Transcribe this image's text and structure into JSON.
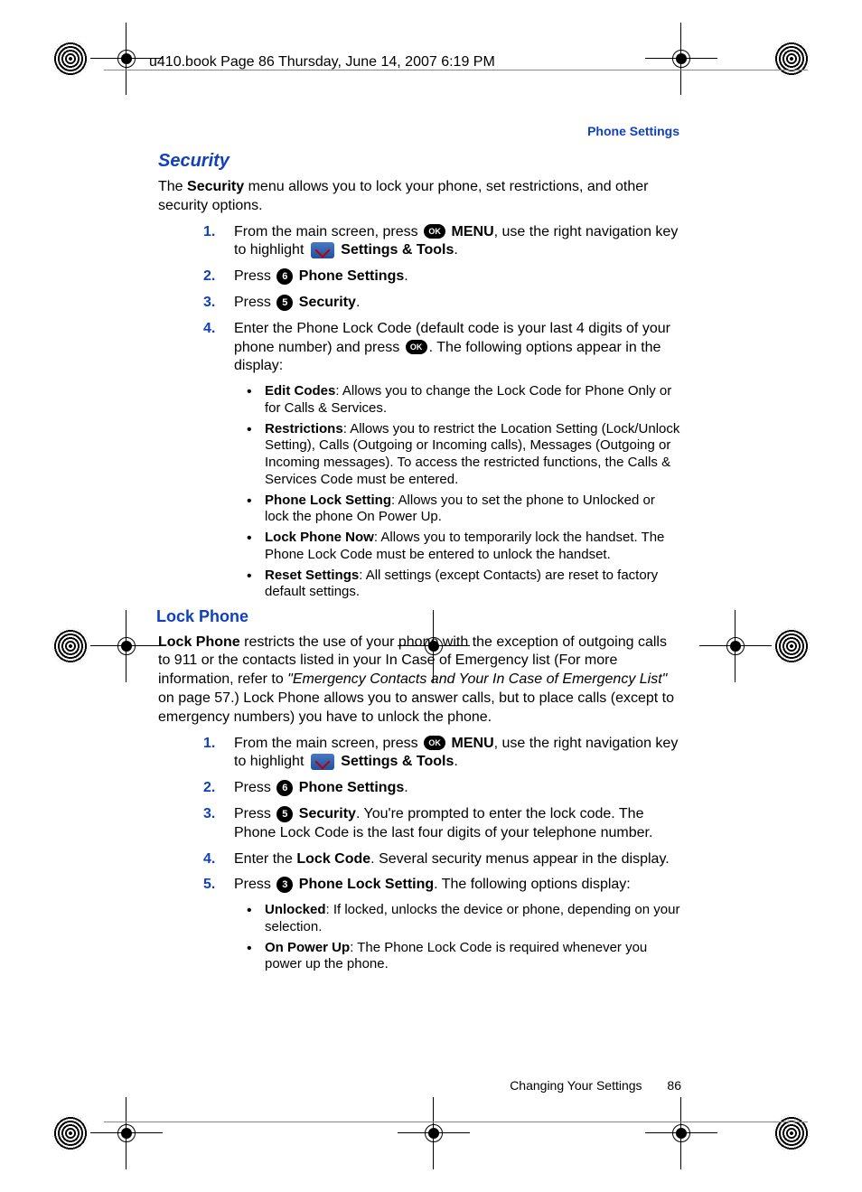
{
  "header_stamp": "u410.book  Page 86  Thursday, June 14, 2007  6:19 PM",
  "section_label": "Phone Settings",
  "h_security": "Security",
  "intro": "The <b>Security</b> menu allows you to lock your phone, set restrictions, and other security options.",
  "steps1": [
    "From the main screen, press [OK] <b>MENU</b>, use the right navigation key to highlight [ST] <b>Settings & Tools</b>.",
    "Press [6] <b>Phone Settings</b>.",
    "Press [5] <b>Security</b>.",
    "Enter the Phone Lock Code (default code is your last 4 digits of your phone number) and press [OK]. The following options appear in the display:"
  ],
  "bullets1": [
    "<b>Edit Codes</b>: Allows you to change the Lock Code for Phone Only or for Calls & Services.",
    "<b>Restrictions</b>: Allows you to restrict the Location Setting (Lock/Unlock Setting), Calls (Outgoing or Incoming calls), Messages (Outgoing or Incoming messages). To access the restricted functions, the Calls & Services Code must be entered.",
    "<b>Phone Lock Setting</b>: Allows you to set the phone to Unlocked or lock the phone On Power Up.",
    "<b>Lock Phone Now</b>: Allows you to temporarily lock the handset. The Phone Lock Code must be entered to unlock the handset.",
    "<b>Reset Settings</b>: All settings (except Contacts) are reset to factory default settings."
  ],
  "h_lockphone": "Lock Phone",
  "lockphone_intro": "<b>Lock Phone</b> restricts the use of your phone with the exception of outgoing calls to 911 or the contacts listed in your In Case of Emergency list (For more information, refer to <i>\"Emergency Contacts and Your In Case of Emergency List\"</i>  on page 57.) Lock Phone allows you to answer calls, but to place calls (except to emergency numbers) you have to unlock the phone.",
  "steps2": [
    "From the main screen, press [OK] <b>MENU</b>, use the right navigation key to highlight [ST] <b>Settings & Tools</b>.",
    "Press [6] <b>Phone Settings</b>.",
    "Press [5] <b>Security</b>. You're prompted to enter the lock code. The Phone Lock Code is the last four digits of your telephone number.",
    "Enter the <b>Lock Code</b>. Several security menus appear in the display.",
    "Press [3] <b>Phone Lock Setting</b>. The following options display:"
  ],
  "bullets2": [
    "<b>Unlocked</b>: If locked, unlocks the device or phone, depending on your selection.",
    "<b>On Power Up</b>: The Phone Lock Code is required whenever you power up the phone."
  ],
  "footer_text": "Changing Your Settings",
  "footer_page": "86",
  "icons": {
    "ok_label": "OK"
  }
}
